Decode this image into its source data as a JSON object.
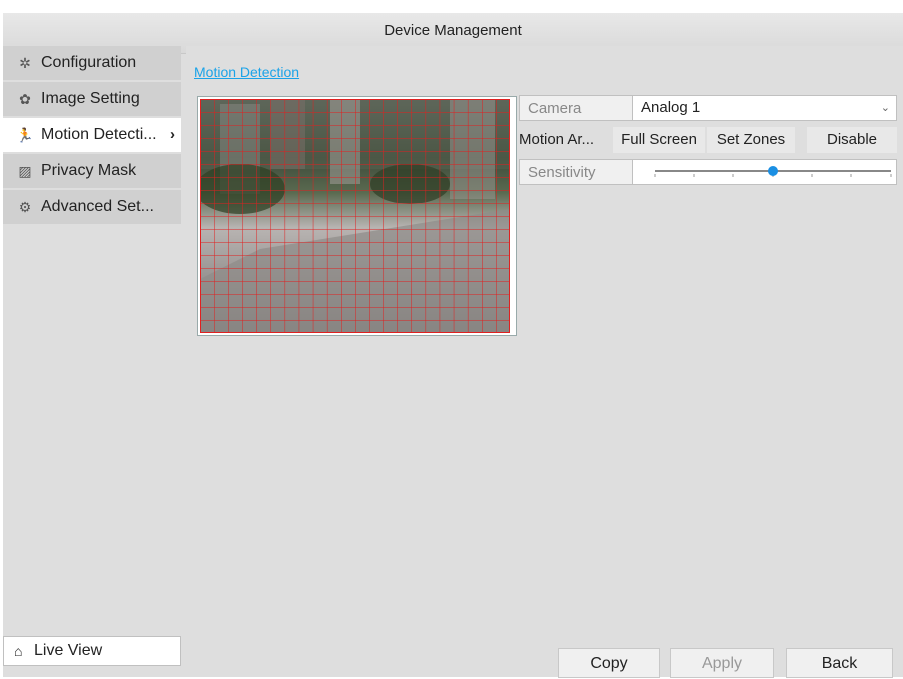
{
  "window": {
    "title": "Device Management"
  },
  "sidebar": {
    "items": [
      {
        "label": "Configuration",
        "icon": "gear-icon"
      },
      {
        "label": "Image Setting",
        "icon": "palette-icon"
      },
      {
        "label": "Motion Detecti...",
        "icon": "running-man-icon",
        "active": true
      },
      {
        "label": "Privacy Mask",
        "icon": "mask-icon"
      },
      {
        "label": "Advanced Set...",
        "icon": "gears-icon"
      }
    ],
    "live_view": "Live View"
  },
  "main": {
    "section_link": "Motion Detection",
    "camera": {
      "label": "Camera",
      "value": "Analog 1"
    },
    "motion_area": {
      "label": "Motion Ar...",
      "full_screen": "Full Screen",
      "set_zones": "Set Zones",
      "disable": "Disable"
    },
    "sensitivity": {
      "label": "Sensitivity",
      "level": 0.5
    }
  },
  "footer": {
    "copy": "Copy",
    "apply": "Apply",
    "back": "Back"
  }
}
